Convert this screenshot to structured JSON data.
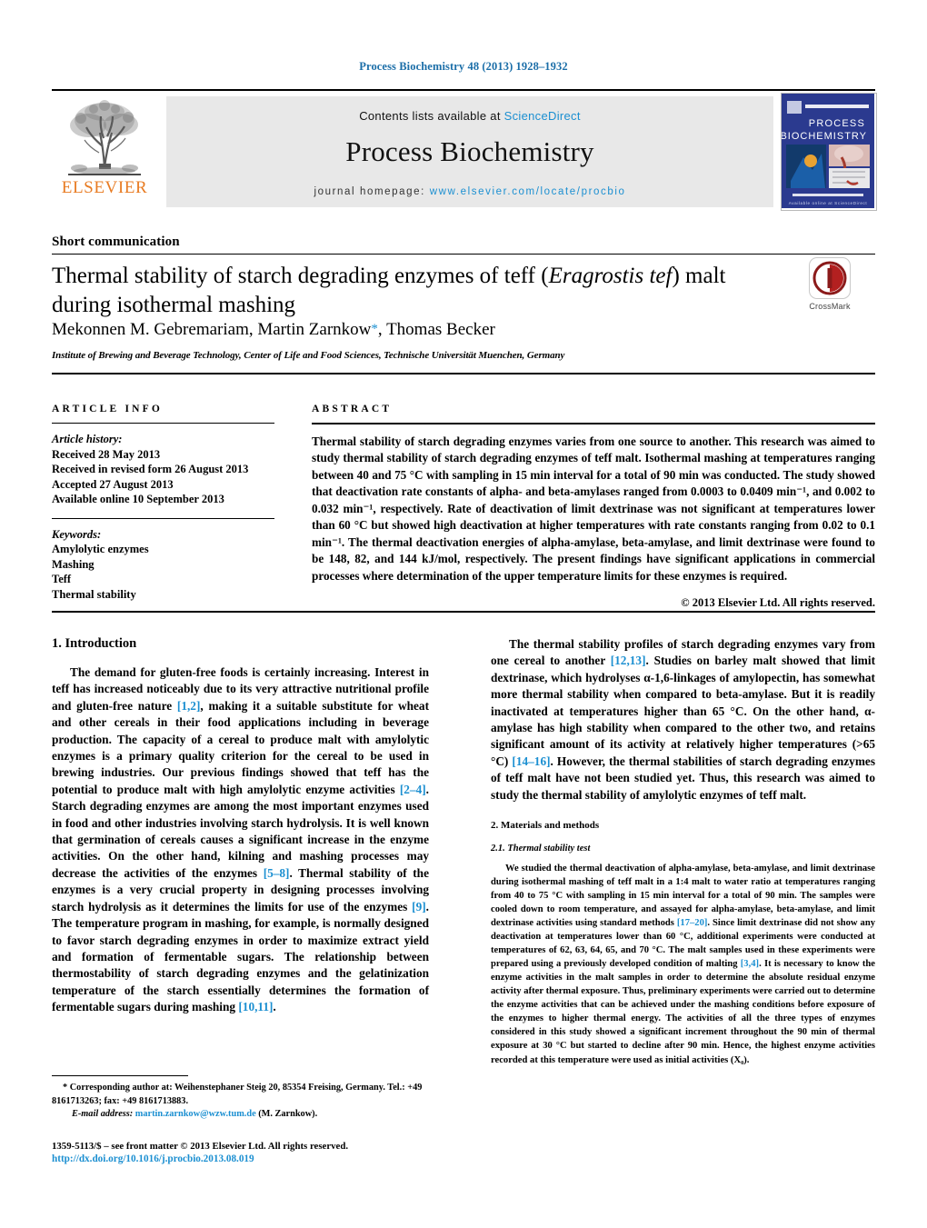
{
  "running_head": "Process Biochemistry 48 (2013) 1928–1932",
  "masthead": {
    "contents_prefix": "Contents lists available at",
    "sciencedirect": "ScienceDirect",
    "journal_title": "Process Biochemistry",
    "homepage_label": "journal homepage:",
    "homepage_url": "www.elsevier.com/locate/procbio",
    "publisher": "ELSEVIER",
    "cover_line1": "PROCESS",
    "cover_line2": "BIOCHEMISTRY",
    "cover_footer": "Available online at ScienceDirect"
  },
  "article": {
    "type": "Short communication",
    "title_part1": "Thermal stability of starch degrading enzymes of teff (",
    "title_italic": "Eragrostis tef",
    "title_part2": ") malt during isothermal mashing",
    "authors": "Mekonnen M. Gebremariam, Martin Zarnkow",
    "authors_tail": ", Thomas Becker",
    "corresponding_marker": "*",
    "affiliation": "Institute of Brewing and Beverage Technology, Center of Life and Food Sciences, Technische Universität Muenchen, Germany",
    "crossmark_label": "CrossMark"
  },
  "article_info": {
    "heading": "ARTICLE INFO",
    "history_label": "Article history:",
    "history": [
      "Received 28 May 2013",
      "Received in revised form 26 August 2013",
      "Accepted 27 August 2013",
      "Available online 10 September 2013"
    ],
    "keywords_label": "Keywords:",
    "keywords": [
      "Amylolytic enzymes",
      "Mashing",
      "Teff",
      "Thermal stability"
    ]
  },
  "abstract": {
    "heading": "ABSTRACT",
    "text": "Thermal stability of starch degrading enzymes varies from one source to another. This research was aimed to study thermal stability of starch degrading enzymes of teff malt. Isothermal mashing at temperatures ranging between 40 and 75 °C with sampling in 15 min interval for a total of 90 min was conducted. The study showed that deactivation rate constants of alpha- and beta-amylases ranged from 0.0003 to 0.0409 min⁻¹, and 0.002 to 0.032 min⁻¹, respectively. Rate of deactivation of limit dextrinase was not significant at temperatures lower than 60 °C but showed high deactivation at higher temperatures with rate constants ranging from 0.02 to 0.1 min⁻¹. The thermal deactivation energies of alpha-amylase, beta-amylase, and limit dextrinase were found to be 148, 82, and 144 kJ/mol, respectively. The present findings have significant applications in commercial processes where determination of the upper temperature limits for these enzymes is required.",
    "copyright": "© 2013 Elsevier Ltd. All rights reserved."
  },
  "body": {
    "intro_heading": "1. Introduction",
    "intro_p1_a": "The demand for gluten-free foods is certainly increasing. Interest in teff has increased noticeably due to its very attractive nutritional profile and gluten-free nature ",
    "intro_p1_ref1": "[1,2]",
    "intro_p1_b": ", making it a suitable substitute for wheat and other cereals in their food applications including in beverage production. The capacity of a cereal to produce malt with amylolytic enzymes is a primary quality criterion for the cereal to be used in brewing industries. Our previous findings showed that teff has the potential to produce malt with high amylolytic enzyme activities ",
    "intro_p1_ref2": "[2–4]",
    "intro_p1_c": ". Starch degrading enzymes are among the most important enzymes used in food and other industries involving starch hydrolysis. It is well known that germination of cereals causes a significant increase in the enzyme activities. On the other hand, kilning and mashing processes may decrease the activities of the enzymes ",
    "intro_p1_ref3": "[5–8]",
    "intro_p1_d": ". Thermal stability of the enzymes is a very crucial property in designing processes involving starch hydrolysis as it determines the limits for use of the enzymes ",
    "intro_p1_ref4": "[9]",
    "intro_p1_e": ". The temperature program in mashing, for example, is normally designed to favor starch degrading enzymes in order to maximize extract yield and formation of fermentable sugars. The relationship between thermostability of starch degrading enzymes and the gelatinization temperature of the starch essentially determines the formation of fermentable sugars during mashing ",
    "intro_p1_ref5": "[10,11]",
    "intro_p1_f": ".",
    "right_p1_a": "The thermal stability profiles of starch degrading enzymes vary from one cereal to another ",
    "right_p1_ref1": "[12,13]",
    "right_p1_b": ". Studies on barley malt showed that limit dextrinase, which hydrolyses α-1,6-linkages of amylopectin, has somewhat more thermal stability when compared to beta-amylase. But it is readily inactivated at temperatures higher than 65 °C. On the other hand, α-amylase has high stability when compared to the other two, and retains significant amount of its activity at relatively higher temperatures (>65 °C) ",
    "right_p1_ref2": "[14–16]",
    "right_p1_c": ". However, the thermal stabilities of starch degrading enzymes of teff malt have not been studied yet. Thus, this research was aimed to study the thermal stability of amylolytic enzymes of teff malt.",
    "methods_heading": "2. Materials and methods",
    "methods_sub_heading": "2.1. Thermal stability test",
    "methods_p_a": "We studied the thermal deactivation of alpha-amylase, beta-amylase, and limit dextrinase during isothermal mashing of teff malt in a 1:4 malt to water ratio at temperatures ranging from 40 to 75 °C with sampling in 15 min interval for a total of 90 min. The samples were cooled down to room temperature, and assayed for alpha-amylase, beta-amylase, and limit dextrinase activities using standard methods ",
    "methods_ref1": "[17–20]",
    "methods_p_b": ". Since limit dextrinase did not show any deactivation at temperatures lower than 60 °C, additional experiments were conducted at temperatures of 62, 63, 64, 65, and 70 °C. The malt samples used in these experiments were prepared using a previously developed condition of malting ",
    "methods_ref2": "[3,4]",
    "methods_p_c": ". It is necessary to know the enzyme activities in the malt samples in order to determine the absolute residual enzyme activity after thermal exposure. Thus, preliminary experiments were carried out to determine the enzyme activities that can be achieved under the mashing conditions before exposure of the enzymes to higher thermal energy. The activities of all the three types of enzymes considered in this study showed a significant increment throughout the 90 min of thermal exposure at 30 °C but started to decline after 90 min. Hence, the highest enzyme activities recorded at this temperature were used as initial activities (X₀)."
  },
  "footnotes": {
    "corresponding_marker": "*",
    "corresponding_text": "Corresponding author at: Weihenstephaner Steig 20, 85354 Freising, Germany. Tel.: +49 8161713263; fax: +49 8161713883.",
    "email_label": "E-mail address:",
    "email_address": "martin.zarnkow@wzw.tum.de",
    "email_owner": "(M. Zarnkow).",
    "issn_line": "1359-5113/$ – see front matter © 2013 Elsevier Ltd. All rights reserved.",
    "doi": "http://dx.doi.org/10.1016/j.procbio.2013.08.019"
  },
  "colors": {
    "link": "#1b8fd1",
    "running_head": "#1b6ea8",
    "elsevier_orange": "#E87B22",
    "cover_blue": "#2b3a8f"
  }
}
